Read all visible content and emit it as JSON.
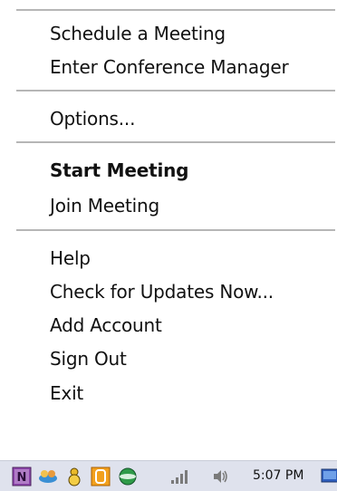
{
  "menu": {
    "items": [
      {
        "label": "Schedule a Meeting"
      },
      {
        "label": "Enter Conference Manager"
      },
      {
        "label": "Options..."
      },
      {
        "label": "Start Meeting"
      },
      {
        "label": "Join Meeting"
      },
      {
        "label": "Help"
      },
      {
        "label": "Check for Updates Now..."
      },
      {
        "label": "Add Account"
      },
      {
        "label": "Sign Out"
      },
      {
        "label": "Exit"
      }
    ]
  },
  "taskbar": {
    "icons": [
      "onenote-icon",
      "network-people-icon",
      "yellow-figure-icon",
      "orange-app-icon",
      "green-app-icon",
      "signal-bars-icon",
      "volume-icon",
      "desktop-icon"
    ],
    "clock": "5:07 PM"
  }
}
